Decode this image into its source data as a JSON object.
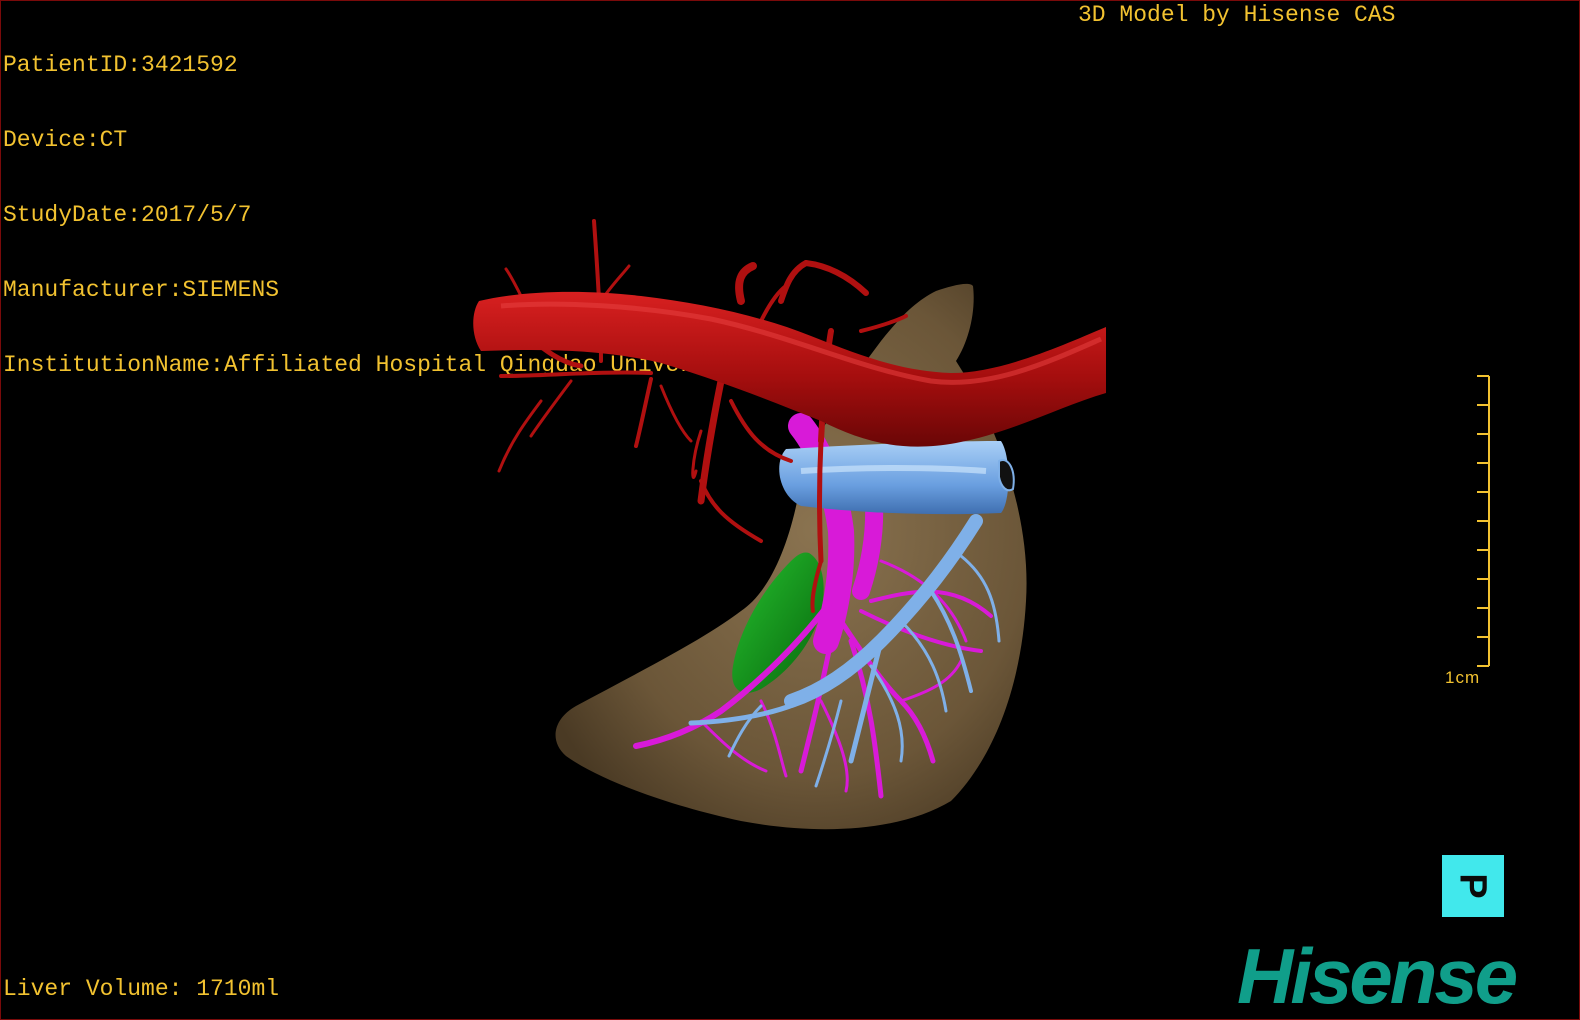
{
  "overlay": {
    "patient_id": "PatientID:3421592",
    "device": "Device:CT",
    "study_date": "StudyDate:2017/5/7",
    "manufacturer": "Manufacturer:SIEMENS",
    "institution": "InstitutionName:Affiliated Hospital Qingdao University-C",
    "model_credit": "3D Model by Hisense CAS",
    "liver_volume": "Liver Volume: 1710ml"
  },
  "scale": {
    "label": "1cm"
  },
  "orientation": {
    "label": "P"
  },
  "logo": {
    "text": "Hisense"
  },
  "colors": {
    "overlay_text": "#f2c230",
    "liver": "#6e5a3c",
    "artery": "#b01010",
    "portal_vein": "#7fb0e8",
    "hepatic_vein": "#d81ad8",
    "gallbladder": "#0f9a1a",
    "orientation_cube": "#41e8ec",
    "logo": "#109e8a"
  },
  "icons": {
    "orientation": "orientation-cube-icon",
    "scale": "scale-ruler-icon"
  }
}
